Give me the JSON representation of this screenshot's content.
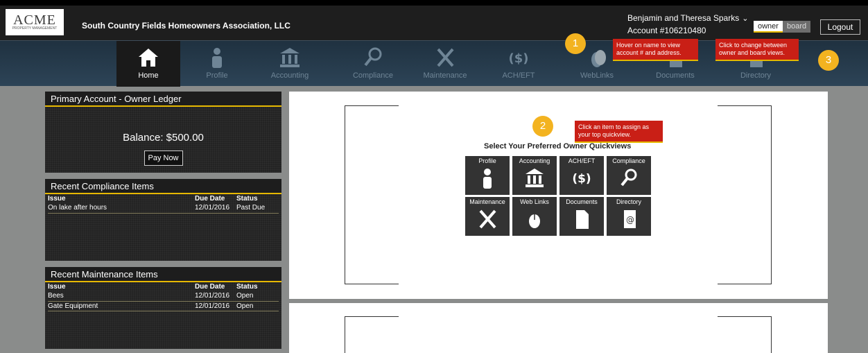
{
  "header": {
    "logo_text": "ACME",
    "logo_sub": "PROPERTY MANAGEMENT",
    "association": "South Country Fields Homeowners Association, LLC",
    "user_name": "Benjamin and Theresa Sparks",
    "account": "Account #106210480",
    "view_owner": "owner",
    "view_board": "board",
    "logout": "Logout"
  },
  "nav": {
    "items": [
      {
        "label": "Home",
        "icon": "home-icon",
        "active": true
      },
      {
        "label": "Profile",
        "icon": "person-icon"
      },
      {
        "label": "Accounting",
        "icon": "bank-icon"
      },
      {
        "label": "Compliance",
        "icon": "magnifier-icon"
      },
      {
        "label": "Maintenance",
        "icon": "tools-icon"
      },
      {
        "label": "ACH/EFT",
        "icon": "dollar-cycle-icon"
      },
      {
        "label": "WebLinks",
        "icon": "mouse-icon"
      },
      {
        "label": "Documents",
        "icon": "document-icon"
      },
      {
        "label": "Directory",
        "icon": "address-book-icon"
      }
    ]
  },
  "ledger": {
    "title": "Primary Account - Owner Ledger",
    "balance": "Balance: $500.00",
    "pay": "Pay Now"
  },
  "compliance": {
    "title": "Recent Compliance Items",
    "headers": [
      "Issue",
      "Due Date",
      "Status"
    ],
    "rows": [
      {
        "issue": "On lake after hours",
        "due": "12/01/2016",
        "status": "Past Due"
      }
    ]
  },
  "maintenance": {
    "title": "Recent Maintenance Items",
    "headers": [
      "Issue",
      "Due Date",
      "Status"
    ],
    "rows": [
      {
        "issue": "Bees",
        "due": "12/01/2016",
        "status": "Open"
      },
      {
        "issue": "Gate Equipment",
        "due": "12/01/2016",
        "status": "Open"
      }
    ]
  },
  "quickviews": {
    "title": "Select Your Preferred Owner Quickviews",
    "tiles": [
      {
        "label": "Profile",
        "icon": "person-icon"
      },
      {
        "label": "Accounting",
        "icon": "bank-icon"
      },
      {
        "label": "ACH/EFT",
        "icon": "dollar-cycle-icon"
      },
      {
        "label": "Compliance",
        "icon": "magnifier-icon"
      },
      {
        "label": "Maintenance",
        "icon": "tools-icon"
      },
      {
        "label": "Web Links",
        "icon": "mouse-icon"
      },
      {
        "label": "Documents",
        "icon": "document-icon"
      },
      {
        "label": "Directory",
        "icon": "address-book-icon"
      }
    ]
  },
  "callouts": [
    {
      "num": "1",
      "text": "Hover on name to view account # and address."
    },
    {
      "num": "2",
      "text": "Click an item to assign as your top quickview."
    },
    {
      "num": "3",
      "text": "Click to change between owner and board views."
    }
  ],
  "colors": {
    "accent": "#e6b800",
    "callout": "#c91f16",
    "badge": "#f3b320",
    "nav": "#2d4457"
  }
}
